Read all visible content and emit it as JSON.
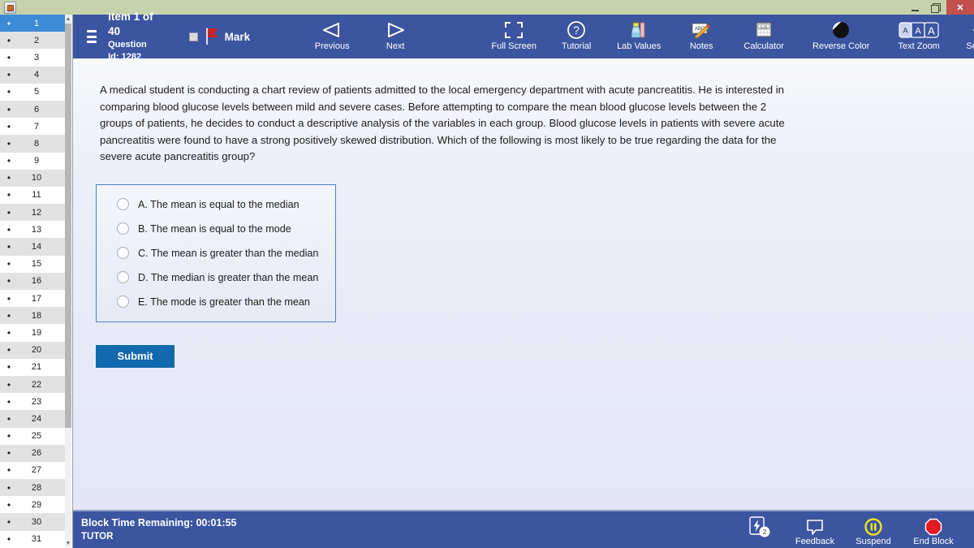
{
  "window": {
    "app_icon": "java-app-icon",
    "minimize_label": "",
    "restore_label": "",
    "close_label": "✕"
  },
  "sidebar": {
    "bullet": "•",
    "selected_index": 1,
    "scroll_up_arrow": "▲",
    "scroll_down_arrow": "▼",
    "items": [
      {
        "number": "1"
      },
      {
        "number": "2"
      },
      {
        "number": "3"
      },
      {
        "number": "4"
      },
      {
        "number": "5"
      },
      {
        "number": "6"
      },
      {
        "number": "7"
      },
      {
        "number": "8"
      },
      {
        "number": "9"
      },
      {
        "number": "10"
      },
      {
        "number": "11"
      },
      {
        "number": "12"
      },
      {
        "number": "13"
      },
      {
        "number": "14"
      },
      {
        "number": "15"
      },
      {
        "number": "16"
      },
      {
        "number": "17"
      },
      {
        "number": "18"
      },
      {
        "number": "19"
      },
      {
        "number": "20"
      },
      {
        "number": "21"
      },
      {
        "number": "22"
      },
      {
        "number": "23"
      },
      {
        "number": "24"
      },
      {
        "number": "25"
      },
      {
        "number": "26"
      },
      {
        "number": "27"
      },
      {
        "number": "28"
      },
      {
        "number": "29"
      },
      {
        "number": "30"
      },
      {
        "number": "31"
      }
    ]
  },
  "toolbar": {
    "menu_icon": "hamburger-menu-icon",
    "item_counter": "Item 1 of 40",
    "question_id": "Question Id: 1282",
    "mark_label": "Mark",
    "mark_checked": false,
    "tools": [
      {
        "label": "Previous",
        "icon": "left-triangle-icon"
      },
      {
        "label": "Next",
        "icon": "right-triangle-icon"
      },
      {
        "label": "Full Screen",
        "icon": "expand-brackets-icon"
      },
      {
        "label": "Tutorial",
        "icon": "question-circle-icon"
      },
      {
        "label": "Lab Values",
        "icon": "lab-flask-icon"
      },
      {
        "label": "Notes",
        "icon": "notes-pencil-icon"
      },
      {
        "label": "Calculator",
        "icon": "calculator-icon"
      },
      {
        "label": "Reverse Color",
        "icon": "half-filled-circle-icon"
      },
      {
        "label": "Text Zoom",
        "icon": "text-zoom-icon"
      },
      {
        "label": "Settings",
        "icon": "gear-icon"
      }
    ],
    "calculator_display": "0.25",
    "notes_glyph_text": "ABC",
    "text_zoom_sizes": [
      "A",
      "A",
      "A"
    ]
  },
  "question": {
    "stem": "A medical student is conducting a chart review of patients admitted to the local emergency department with acute pancreatitis.  He is interested in comparing blood glucose levels between mild and severe cases.  Before attempting to compare the mean blood glucose levels between the 2 groups of patients, he decides to conduct a descriptive analysis of the variables in each group.  Blood glucose levels in patients with severe acute pancreatitis were found to have a strong positively skewed distribution.  Which of the following is most likely to be true regarding the data for the severe acute pancreatitis group?",
    "choices": [
      {
        "letter": "A.",
        "text": "The mean is equal to the median",
        "selected": false
      },
      {
        "letter": "B.",
        "text": "The mean is equal to the mode",
        "selected": false
      },
      {
        "letter": "C.",
        "text": "The mean is greater than the median",
        "selected": false
      },
      {
        "letter": "D.",
        "text": "The median is greater than the mean",
        "selected": false
      },
      {
        "letter": "E.",
        "text": "The mode is greater than the mean",
        "selected": false
      }
    ],
    "submit_label": "Submit"
  },
  "statusbar": {
    "block_time": "Block Time Remaining: 00:01:55",
    "mode": "TUTOR",
    "tools": [
      {
        "label": "",
        "icon": "lightning-count-icon",
        "badge": "2"
      },
      {
        "label": "Feedback",
        "icon": "speech-bubble-icon"
      },
      {
        "label": "Suspend",
        "icon": "pause-circle-icon"
      },
      {
        "label": "End Block",
        "icon": "stop-octagon-icon"
      }
    ]
  },
  "colors": {
    "toolbar_blue": "#3b55a0",
    "selected_row_blue": "#3d8ad6",
    "submit_blue": "#1269ad",
    "desktop_green": "#c6d2ab",
    "close_red": "#c0514d",
    "flag_red": "#cc2229",
    "suspend_yellow": "#f2e41a",
    "endblock_red": "#e01b22",
    "choices_border": "#4a7fc1"
  }
}
